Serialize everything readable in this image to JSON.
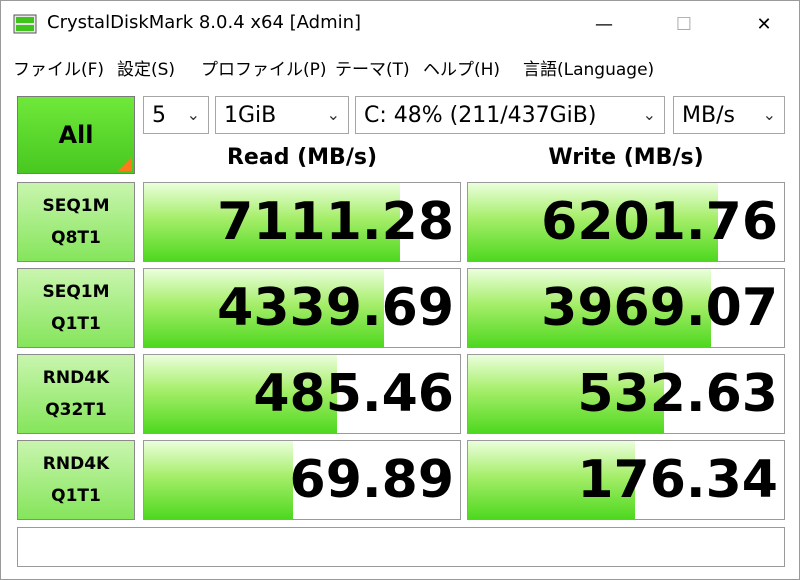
{
  "window": {
    "title": "CrystalDiskMark 8.0.4 x64 [Admin]",
    "min_glyph": "—",
    "max_glyph": "☐",
    "close_glyph": "✕"
  },
  "menu": [
    "ファイル(F)",
    "設定(S)",
    "プロファイル(P)",
    "テーマ(T)",
    "ヘルプ(H)",
    "言語(Language)"
  ],
  "controls": {
    "all_label": "All",
    "count": "5",
    "size": "1GiB",
    "drive": "C: 48% (211/437GiB)",
    "unit": "MB/s"
  },
  "columns": {
    "read": "Read (MB/s)",
    "write": "Write (MB/s)"
  },
  "rows": [
    {
      "line1": "SEQ1M",
      "line2": "Q8T1",
      "read": "7111.28",
      "write": "6201.76"
    },
    {
      "line1": "SEQ1M",
      "line2": "Q1T1",
      "read": "4339.69",
      "write": "3969.07"
    },
    {
      "line1": "RND4K",
      "line2": "Q32T1",
      "read": "485.46",
      "write": "532.63"
    },
    {
      "line1": "RND4K",
      "line2": "Q1T1",
      "read": "69.89",
      "write": "176.34"
    }
  ],
  "bar_fill_percent": {
    "read": [
      81,
      76,
      61,
      47
    ],
    "write": [
      79,
      77,
      62,
      53
    ]
  },
  "colors": {
    "accent_green": "#48c820",
    "corner_orange": "#ff7a1a"
  },
  "icons": {
    "app": "crystaldiskmark-app-icon",
    "chevron": "chevron-down-icon"
  },
  "comment": ""
}
